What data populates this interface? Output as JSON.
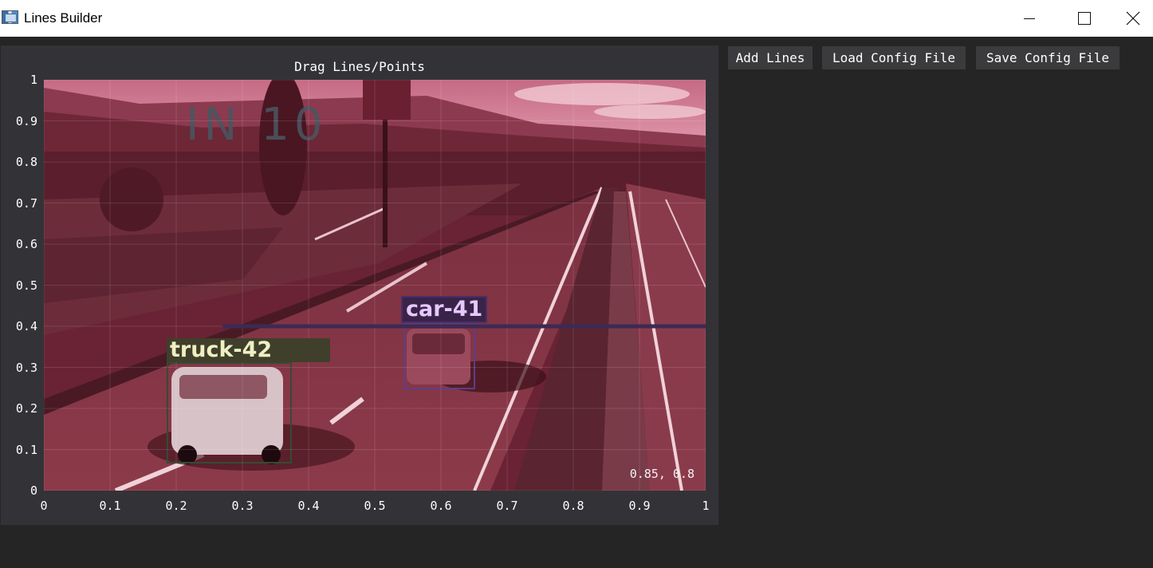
{
  "window": {
    "title": "Lines Builder",
    "icon": "app-window-icon",
    "controls": [
      "minimize-icon",
      "maximize-icon",
      "close-icon"
    ]
  },
  "plot": {
    "title": "Drag Lines/Points",
    "x_ticks": [
      "0",
      "0.1",
      "0.2",
      "0.3",
      "0.4",
      "0.5",
      "0.6",
      "0.7",
      "0.8",
      "0.9",
      "1"
    ],
    "y_ticks": [
      "1",
      "0.9",
      "0.8",
      "0.7",
      "0.6",
      "0.5",
      "0.4",
      "0.3",
      "0.2",
      "0.1",
      "0"
    ],
    "xlim": [
      0,
      1
    ],
    "ylim": [
      0,
      1
    ],
    "grid": true,
    "cursor_readout": "0.85, 0.8",
    "overlay_text": "IN 10",
    "detections": [
      {
        "label": "car-41",
        "color": "#9a5bd6"
      },
      {
        "label": "truck-42",
        "color": "#d6d68a"
      }
    ],
    "line": {
      "x": [
        0.27,
        1.0
      ],
      "y": [
        0.4,
        0.4
      ],
      "color": "#3c2a55"
    }
  },
  "toolbar": {
    "add_lines": "Add Lines",
    "load_config": "Load Config File",
    "save_config": "Save Config File"
  },
  "colors": {
    "background": "#252526",
    "panel": "#333337",
    "button": "#3b3b3e",
    "image_tint": "#8a2e45"
  }
}
